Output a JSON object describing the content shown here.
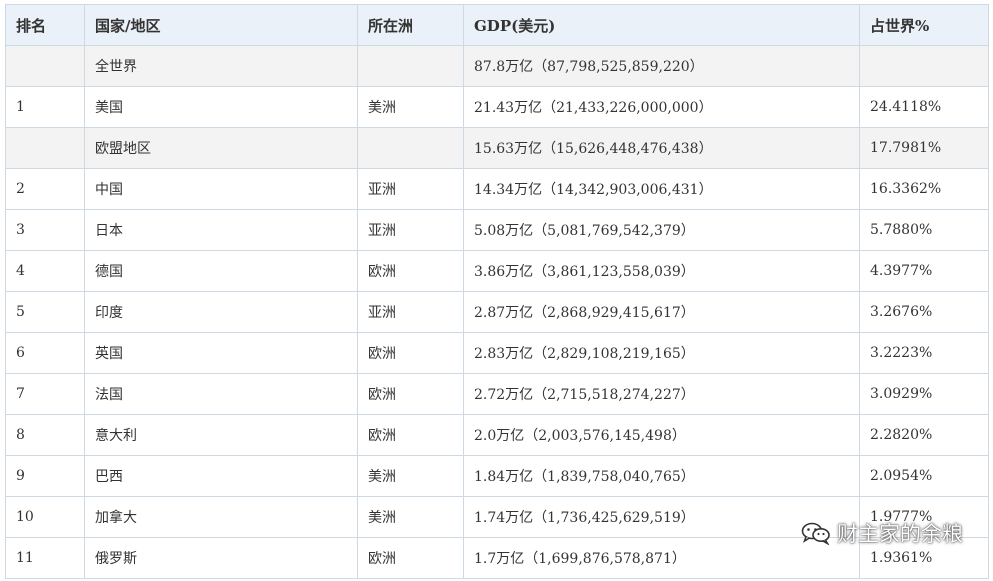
{
  "table": {
    "headers": [
      "排名",
      "国家/地区",
      "所在洲",
      "GDP(美元)",
      "占世界%"
    ],
    "rows": [
      {
        "rank": "",
        "name": "全世界",
        "continent": "",
        "gdp": "87.8万亿（87,798,525,859,220）",
        "share": "",
        "highlight": true
      },
      {
        "rank": "1",
        "name": "美国",
        "continent": "美洲",
        "gdp": "21.43万亿（21,433,226,000,000）",
        "share": "24.4118%",
        "highlight": false
      },
      {
        "rank": "",
        "name": "欧盟地区",
        "continent": "",
        "gdp": "15.63万亿（15,626,448,476,438）",
        "share": "17.7981%",
        "highlight": true
      },
      {
        "rank": "2",
        "name": "中国",
        "continent": "亚洲",
        "gdp": "14.34万亿（14,342,903,006,431）",
        "share": "16.3362%",
        "highlight": false
      },
      {
        "rank": "3",
        "name": "日本",
        "continent": "亚洲",
        "gdp": "5.08万亿（5,081,769,542,379）",
        "share": "5.7880%",
        "highlight": false
      },
      {
        "rank": "4",
        "name": "德国",
        "continent": "欧洲",
        "gdp": "3.86万亿（3,861,123,558,039）",
        "share": "4.3977%",
        "highlight": false
      },
      {
        "rank": "5",
        "name": "印度",
        "continent": "亚洲",
        "gdp": "2.87万亿（2,868,929,415,617）",
        "share": "3.2676%",
        "highlight": false
      },
      {
        "rank": "6",
        "name": "英国",
        "continent": "欧洲",
        "gdp": "2.83万亿（2,829,108,219,165）",
        "share": "3.2223%",
        "highlight": false
      },
      {
        "rank": "7",
        "name": "法国",
        "continent": "欧洲",
        "gdp": "2.72万亿（2,715,518,274,227）",
        "share": "3.0929%",
        "highlight": false
      },
      {
        "rank": "8",
        "name": "意大利",
        "continent": "欧洲",
        "gdp": "2.0万亿（2,003,576,145,498）",
        "share": "2.2820%",
        "highlight": false
      },
      {
        "rank": "9",
        "name": "巴西",
        "continent": "美洲",
        "gdp": "1.84万亿（1,839,758,040,765）",
        "share": "2.0954%",
        "highlight": false
      },
      {
        "rank": "10",
        "name": "加拿大",
        "continent": "美洲",
        "gdp": "1.74万亿（1,736,425,629,519）",
        "share": "1.9777%",
        "highlight": false
      },
      {
        "rank": "11",
        "name": "俄罗斯",
        "continent": "欧洲",
        "gdp": "1.7万亿（1,699,876,578,871）",
        "share": "1.9361%",
        "highlight": false
      }
    ]
  },
  "watermark": {
    "text": "财主家的余粮",
    "icon": "wechat-icon"
  },
  "colors": {
    "header_bg": "#eaf1f8",
    "highlight_row_bg": "#f3f3f3",
    "border": "#cfd9e3",
    "text": "#333333"
  }
}
